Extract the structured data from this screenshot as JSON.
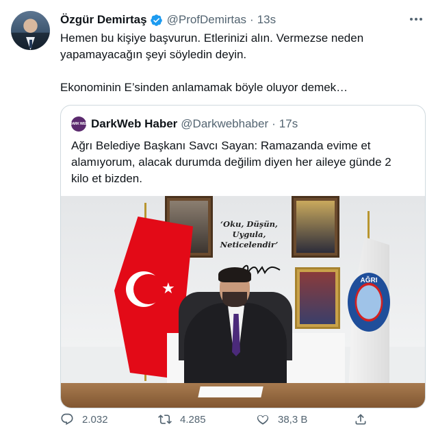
{
  "author": {
    "name": "Özgür Demirtaş",
    "handle": "@ProfDemirtas",
    "separator": "·",
    "time": "13s",
    "verified_color": "#1d9bf0"
  },
  "tweet": {
    "lines": [
      "Hemen bu kişiye başvurun. Etlerinizi alın. Vermezse neden",
      "yapamayacağın şeyi söyledin deyin.",
      "Ekonominin E’sinden anlamamak böyle oluyor demek…"
    ]
  },
  "quote": {
    "avatar_text": "DARK WEB",
    "name": "DarkWeb Haber",
    "handle": "@Darkwebhaber",
    "separator": "·",
    "time": "17s",
    "lines": [
      "Ağrı Belediye Başkanı Savcı Sayan: Ramazanda evime et",
      "alamıyorum, alacak durumda değilim diyen her aileye günde 2",
      "kilo et bizden."
    ],
    "photo": {
      "motto_lines": [
        "‘Oku, Düşün,",
        "Uygula,",
        "Neticelendir’"
      ],
      "emblem_text": "AĞRI"
    }
  },
  "actions": {
    "reply_count": "2.032",
    "retweet_count": "4.285",
    "like_count": "38,3 B"
  },
  "icons": [
    "verified-badge-icon",
    "more-options-icon",
    "reply-icon",
    "retweet-icon",
    "like-icon",
    "share-icon"
  ]
}
